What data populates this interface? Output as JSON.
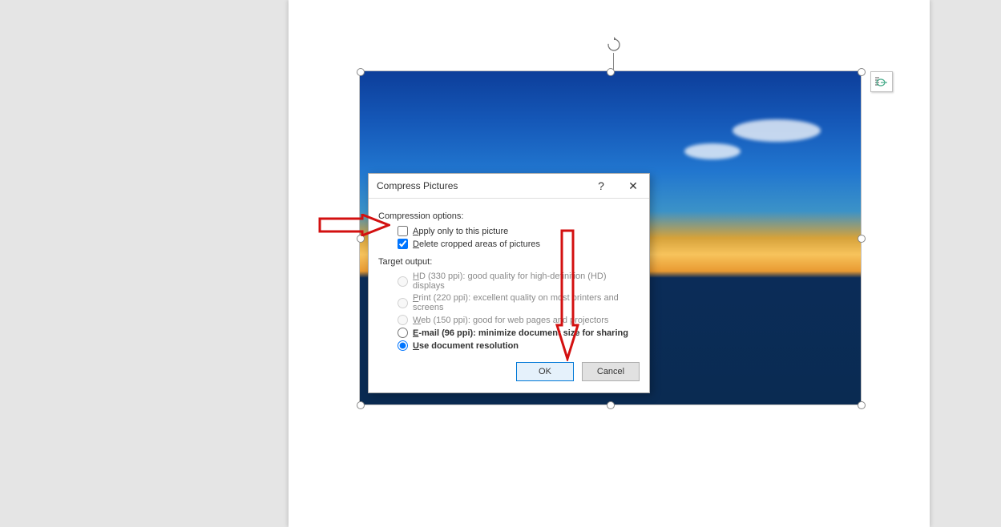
{
  "dialog": {
    "title": "Compress Pictures",
    "help_symbol": "?",
    "close_symbol": "✕",
    "compression_options_label": "Compression options:",
    "apply_only": {
      "label_pre": "A",
      "label": "pply only to this picture",
      "checked": false
    },
    "delete_cropped": {
      "label_pre": "D",
      "label": "elete cropped areas of pictures",
      "checked": true
    },
    "target_output_label": "Target output:",
    "hd": {
      "pre": "H",
      "mono": "D (330 ppi): good quality for high-definition (HD) displays"
    },
    "print": {
      "pre": "P",
      "mono": "rint (220 ppi): excellent quality on most printers and screens"
    },
    "web": {
      "pre": "W",
      "mono": "eb (150 ppi): good for web pages and projectors"
    },
    "email": {
      "pre": "E",
      "mono": "-mail (96 ppi): minimize document size for sharing"
    },
    "docres": {
      "pre": "U",
      "mono": "se document resolution"
    },
    "ok_label": "OK",
    "cancel_label": "Cancel"
  },
  "layout_btn_icon": "layout-options-icon"
}
